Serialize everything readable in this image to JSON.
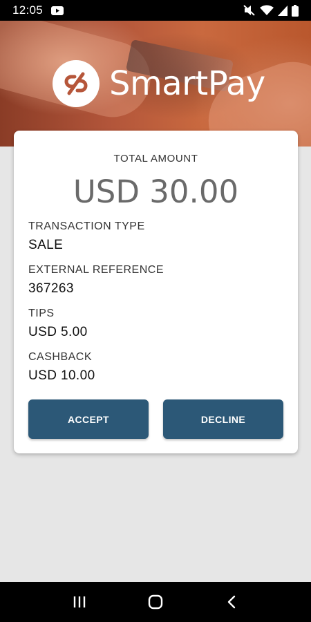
{
  "status_bar": {
    "time": "12:05",
    "icons": [
      "youtube-icon",
      "mute-icon",
      "wifi-icon",
      "signal-icon",
      "battery-icon"
    ]
  },
  "brand": {
    "name": "SmartPay",
    "logo_icon": "smartpay-logo-icon"
  },
  "transaction": {
    "total_label": "TOTAL AMOUNT",
    "total_value": "USD 30.00",
    "fields": [
      {
        "label": "TRANSACTION TYPE",
        "value": "SALE"
      },
      {
        "label": "EXTERNAL REFERENCE",
        "value": "367263"
      },
      {
        "label": "TIPS",
        "value": "USD 5.00"
      },
      {
        "label": "CASHBACK",
        "value": "USD 10.00"
      }
    ]
  },
  "actions": {
    "accept_label": "ACCEPT",
    "decline_label": "DECLINE"
  },
  "nav_bar": {
    "buttons": [
      "recent-apps-icon",
      "home-icon",
      "back-icon"
    ]
  },
  "colors": {
    "button": "#2c5877",
    "background": "#e6e6e6",
    "card": "#ffffff"
  }
}
